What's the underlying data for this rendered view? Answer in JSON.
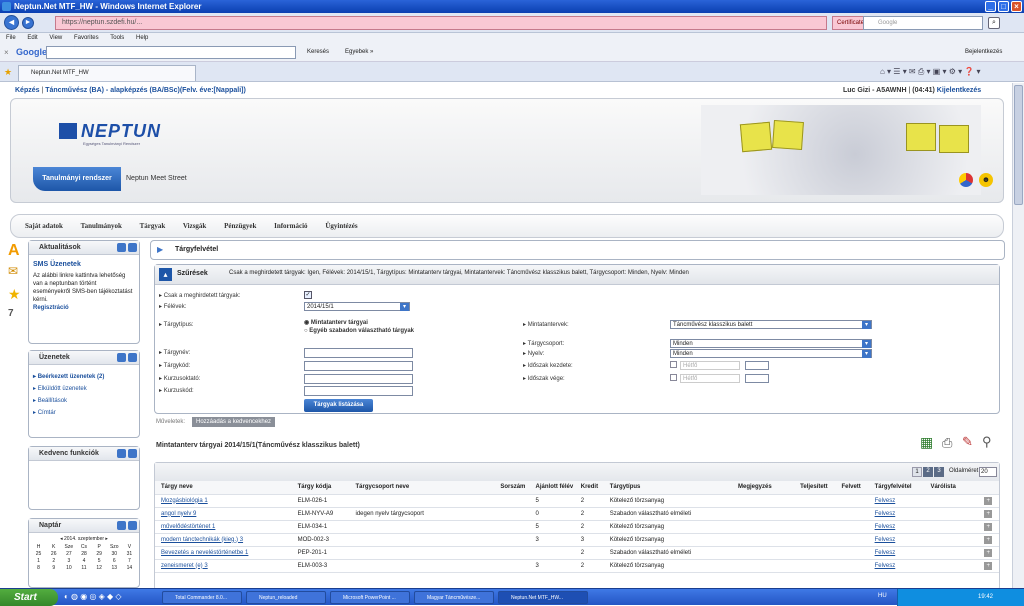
{
  "window": {
    "title": "Neptun.Net MTF_HW - Windows Internet Explorer"
  },
  "browser": {
    "url": "https://neptun.szdefi.hu/...",
    "cert_error": "Certificate Error",
    "search_placeholder": "Google",
    "menu": [
      "File",
      "Edit",
      "View",
      "Favorites",
      "Tools",
      "Help"
    ],
    "google_label": "Google",
    "google_go": "Keresés",
    "google_more": "Egyebek »",
    "bejelentkezes": "Bejelentkezés",
    "tab_title": "Neptun.Net MTF_HW"
  },
  "topbar": {
    "left_training": "Képzés",
    "left_training_name": "Táncművész (BA) - alapképzés (BA/BSc)(Felv. éve:[Nappali])",
    "user": "Luc Gizi - A5AWNH",
    "timer": "(04:41)",
    "logout": "Kijelentkezés"
  },
  "banner": {
    "logo_text": "NEPTUN",
    "logo_sub": "Egységes Tanulmányi Rendszer",
    "tab_active": "Tanulmányi rendszer",
    "tab_other": "Neptun Meet Street"
  },
  "mainnav": [
    "Saját adatok",
    "Tanulmányok",
    "Tárgyak",
    "Vizsgák",
    "Pénzügyek",
    "Információ",
    "Ügyintézés"
  ],
  "sidebar": {
    "news": {
      "title": "Aktualitások",
      "heading": "SMS Üzenetek",
      "text": "Az alábbi linkre kattintva lehetőség van a neptunban történt eseményekről SMS-ben tájékoztatást kérni.",
      "link": "Regisztráció"
    },
    "messages": {
      "title": "Üzenetek",
      "items": [
        "Beérkezett üzenetek (2)",
        "Elküldött üzenetek",
        "Beállítások",
        "Címtár"
      ]
    },
    "favorites": {
      "title": "Kedvenc funkciók"
    },
    "calendar": {
      "title": "Naptár",
      "month": "2014. szeptember",
      "days": [
        "H",
        "K",
        "Sze",
        "Cs",
        "P",
        "Szo",
        "V"
      ],
      "weeks": [
        [
          "25",
          "26",
          "27",
          "28",
          "29",
          "30",
          "31"
        ],
        [
          "1",
          "2",
          "3",
          "4",
          "5",
          "6",
          "7"
        ],
        [
          "8",
          "9",
          "10",
          "11",
          "12",
          "13",
          "14"
        ]
      ]
    }
  },
  "page_title": "Tárgyfelvétel",
  "filter": {
    "title": "Szűrések",
    "summary": "Csak a meghirdetett tárgyak: Igen, Félévek: 2014/15/1, Tárgytípus: Mintatanterv tárgyai, Mintatantervek: Táncművész klasszikus balett, Tárgycsoport: Minden, Nyelv: Minden",
    "labels": {
      "csak": "Csak a meghirdetett tárgyak:",
      "felevek": "Félévek:",
      "targytipus": "Tárgytípus:",
      "targynev": "Tárgynév:",
      "targykod": "Tárgykód:",
      "kurzusoktato": "Kurzusoktató:",
      "kurzuskod": "Kurzuskód:",
      "mintatantervek": "Mintatantervek:",
      "targycsoport": "Tárgycsoport:",
      "nyelv": "Nyelv:",
      "idoszak_kezdete": "Időszak kezdete:",
      "idoszak_vege": "Időszak vége:"
    },
    "values": {
      "felevek": "2014/15/1",
      "radio1": "Mintatanterv tárgyai",
      "radio2": "Egyéb szabadon választható tárgyak",
      "mintatanterv": "Táncművész klasszikus balett",
      "targycsoport": "Minden",
      "nyelv": "Minden",
      "nap1": "Hétfő",
      "nap2": "Hétfő"
    },
    "button": "Tárgyak listázása"
  },
  "actions": {
    "label": "Műveletek:",
    "button": "Hozzáadás a kedvencekhez"
  },
  "list": {
    "title": "Mintatanterv tárgyai 2014/15/1(Táncművész klasszikus balett)",
    "pages": [
      "1",
      "2",
      "3"
    ],
    "pagesize_label": "Oldalméret",
    "pagesize": "20",
    "columns": [
      "Tárgy neve",
      "Tárgy kódja",
      "Tárgycsoport neve",
      "Sorszám",
      "Ajánlott félév",
      "Kredit",
      "Tárgytípus",
      "Megjegyzés",
      "Teljesített",
      "Felvett",
      "Tárgyfelvétel",
      "Várólista"
    ],
    "rows": [
      [
        "Mozgásbiológia 1",
        "ELM-026-1",
        "",
        "",
        "5",
        "2",
        "Kötelező törzsanyag",
        "",
        "",
        "",
        "Felvesz",
        ""
      ],
      [
        "angol nyelv 9",
        "ELM-NYV-A9",
        "idegen nyelv tárgycsoport",
        "",
        "0",
        "2",
        "Szabadon választható elméleti",
        "",
        "",
        "",
        "Felvesz",
        ""
      ],
      [
        "művelődéstörténet 1",
        "ELM-034-1",
        "",
        "",
        "5",
        "2",
        "Kötelező törzsanyag",
        "",
        "",
        "",
        "Felvesz",
        ""
      ],
      [
        "modern tánctechnikák (kieg.) 3",
        "MOD-002-3",
        "",
        "",
        "3",
        "3",
        "Kötelező törzsanyag",
        "",
        "",
        "",
        "Felvesz",
        ""
      ],
      [
        "Bevezetés a neveléstörténetbe 1",
        "PEP-201-1",
        "",
        "",
        "",
        "2",
        "Szabadon választható elméleti",
        "",
        "",
        "",
        "Felvesz",
        ""
      ],
      [
        "zeneismeret (e) 3",
        "ELM-003-3",
        "",
        "",
        "3",
        "2",
        "Kötelező törzsanyag",
        "",
        "",
        "",
        "Felvesz",
        ""
      ]
    ]
  },
  "taskbar": {
    "start": "Start",
    "items": [
      "Total Commander 8.0...",
      "Neptun_reloaded",
      "Microsoft PowerPoint ...",
      "Magyar Táncművésze...",
      "Neptun.Net MTF_HW..."
    ],
    "lang": "HU",
    "clock": "19:42"
  }
}
